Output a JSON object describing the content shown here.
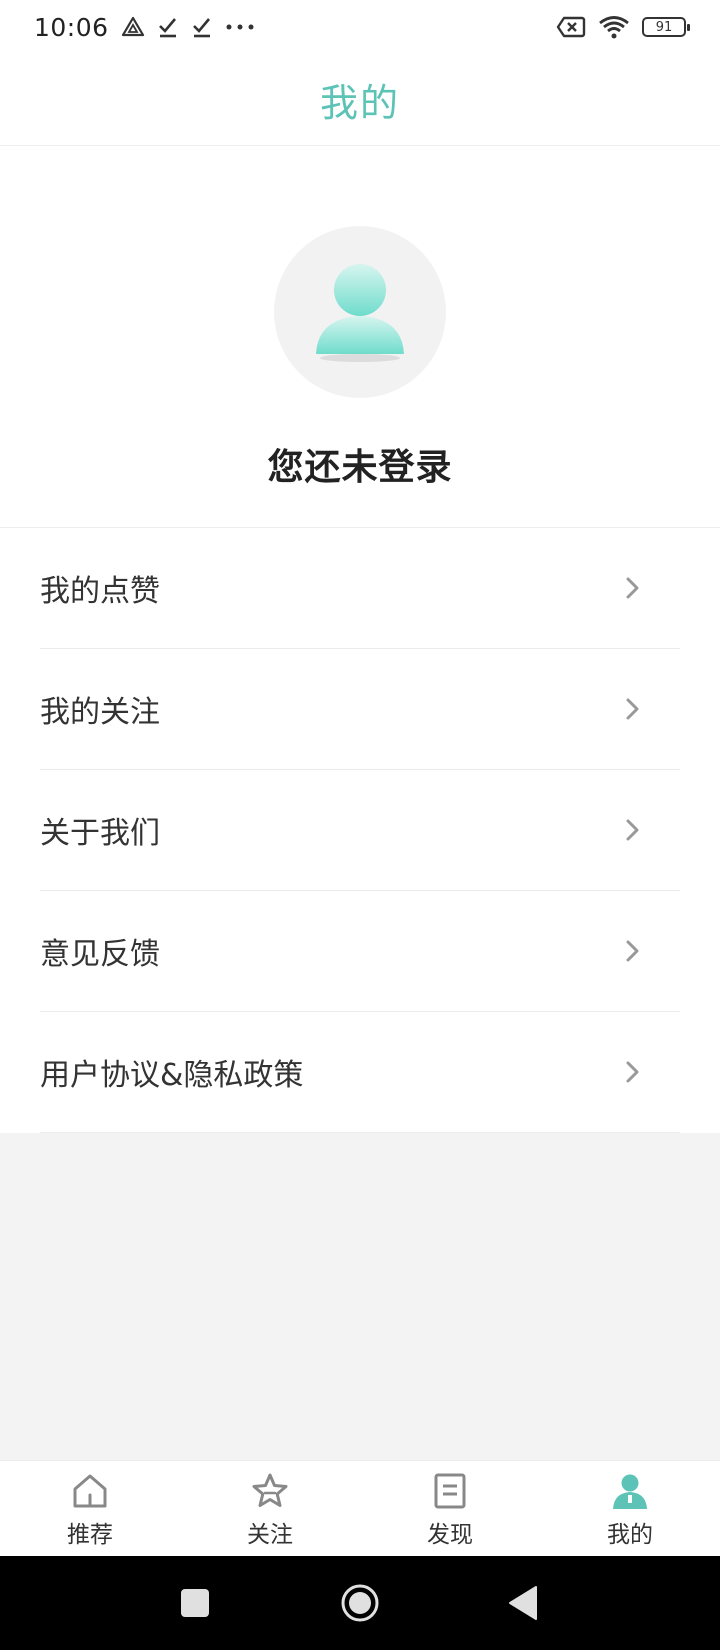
{
  "status_bar": {
    "time": "10:06",
    "battery": "91"
  },
  "header": {
    "title": "我的"
  },
  "profile": {
    "login_status": "您还未登录"
  },
  "menu": {
    "items": [
      {
        "label": "我的点赞"
      },
      {
        "label": "我的关注"
      },
      {
        "label": "关于我们"
      },
      {
        "label": "意见反馈"
      },
      {
        "label": "用户协议&隐私政策"
      }
    ]
  },
  "tabbar": {
    "tabs": [
      {
        "label": "推荐",
        "icon": "home-icon",
        "active": false
      },
      {
        "label": "关注",
        "icon": "star-icon",
        "active": false
      },
      {
        "label": "发现",
        "icon": "document-icon",
        "active": false
      },
      {
        "label": "我的",
        "icon": "user-icon",
        "active": true
      }
    ]
  },
  "colors": {
    "accent": "#5cc3b6",
    "background": "#f3f3f3",
    "text": "#333333"
  }
}
